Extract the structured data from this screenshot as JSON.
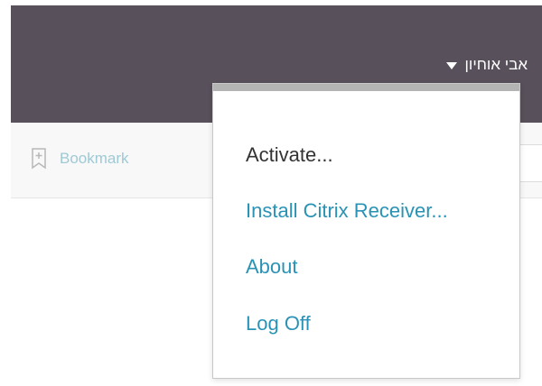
{
  "header": {
    "user_name": "אבי אוחיון",
    "background": "#58505a"
  },
  "toolbar": {
    "bookmark_label": "Bookmark",
    "bookmark_icon": "bookmark-plus-icon"
  },
  "user_dropdown": {
    "items": [
      {
        "label": "Activate..."
      },
      {
        "label": "Install Citrix Receiver..."
      },
      {
        "label": "About"
      },
      {
        "label": "Log Off"
      }
    ],
    "accent_color": "#2a93b5"
  }
}
